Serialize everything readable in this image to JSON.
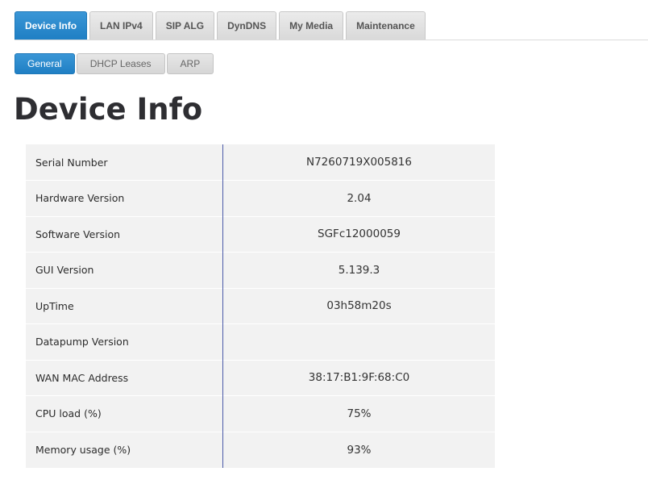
{
  "tabs": [
    {
      "label": "Device Info",
      "active": true
    },
    {
      "label": "LAN IPv4",
      "active": false
    },
    {
      "label": "SIP ALG",
      "active": false
    },
    {
      "label": "DynDNS",
      "active": false
    },
    {
      "label": "My Media",
      "active": false
    },
    {
      "label": "Maintenance",
      "active": false
    }
  ],
  "subtabs": [
    {
      "label": "General",
      "active": true
    },
    {
      "label": "DHCP Leases",
      "active": false
    },
    {
      "label": "ARP",
      "active": false
    }
  ],
  "page": {
    "title": "Device Info"
  },
  "info": {
    "rows": [
      {
        "label": "Serial Number",
        "value": "N7260719X005816"
      },
      {
        "label": "Hardware Version",
        "value": "2.04"
      },
      {
        "label": "Software Version",
        "value": "SGFc12000059"
      },
      {
        "label": "GUI Version",
        "value": "5.139.3"
      },
      {
        "label": "UpTime",
        "value": "03h58m20s"
      },
      {
        "label": "Datapump Version",
        "value": ""
      },
      {
        "label": "WAN MAC Address",
        "value": "38:17:B1:9F:68:C0"
      },
      {
        "label": "CPU load (%)",
        "value": "75%"
      },
      {
        "label": "Memory usage (%)",
        "value": "93%"
      }
    ]
  },
  "colors": {
    "accent": "#2a8acf",
    "tab_inactive": "#e0e0e0",
    "table_bg": "#f2f2f2",
    "divider": "#4a5aa8"
  }
}
